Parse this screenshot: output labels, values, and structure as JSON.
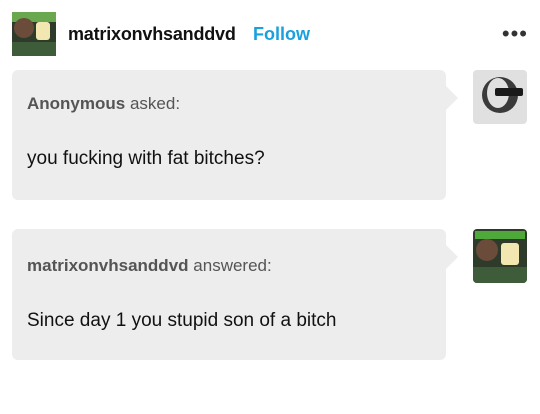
{
  "post": {
    "username": "matrixonvhsanddvd",
    "follow_label": "Follow",
    "more_label": "•••"
  },
  "ask": {
    "asker": "Anonymous",
    "verb": "asked:",
    "question": "you fucking with fat bitches?"
  },
  "answer": {
    "author": "matrixonvhsanddvd",
    "verb": "answered:",
    "text": "Since day 1 you stupid son of a bitch"
  },
  "colors": {
    "follow": "#19a0dd",
    "bubble": "#ededed"
  }
}
